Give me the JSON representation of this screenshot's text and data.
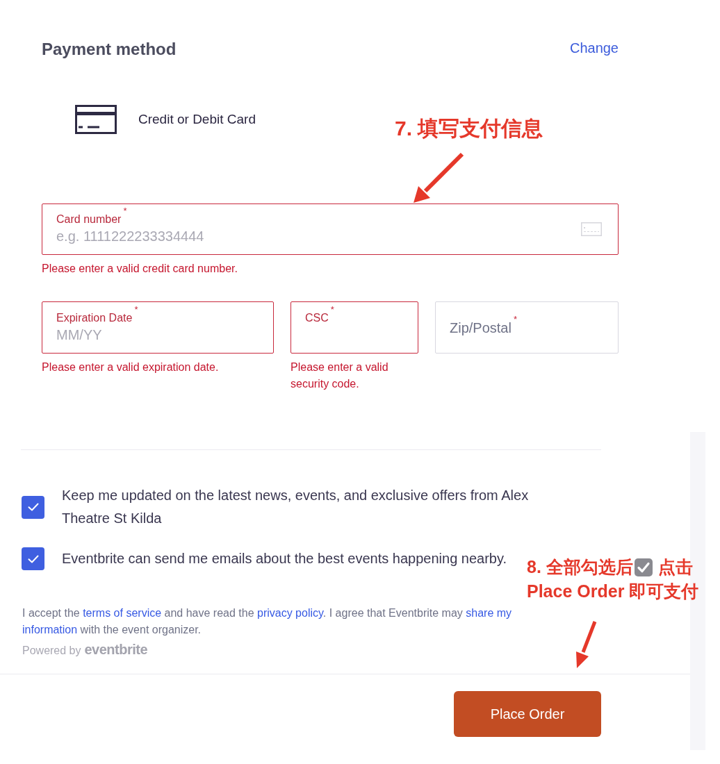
{
  "header": {
    "title": "Payment method",
    "change_link": "Change"
  },
  "payment_option": {
    "label": "Credit or Debit Card"
  },
  "field_rows": [
    {
      "fields": [
        {
          "kind": "card_number",
          "label": "Card number",
          "required_mark": "*",
          "placeholder": "e.g. 1111222233334444",
          "invalid": true,
          "label_floated": true,
          "error": "Please enter a valid credit card number."
        }
      ]
    },
    {
      "fields": [
        {
          "kind": "expiry",
          "label": "Expiration Date",
          "required_mark": "*",
          "placeholder": "MM/YY",
          "invalid": true,
          "label_floated": true,
          "error": "Please enter a valid expiration date."
        },
        {
          "kind": "csc",
          "label": "CSC",
          "required_mark": "*",
          "invalid": true,
          "label_floated": true,
          "error": "Please enter a valid security code."
        },
        {
          "kind": "postal",
          "label": "Zip/Postal",
          "required_mark": "*",
          "invalid": false,
          "label_floated": false
        }
      ]
    }
  ],
  "checkboxes": [
    {
      "label": "Keep me updated on the latest news, events, and exclusive offers from Alex Theatre St Kilda",
      "checked": true
    },
    {
      "label": "Eventbrite can send me emails about the best events happening nearby.",
      "checked": true
    }
  ],
  "legal_text": [
    {
      "kind": "text",
      "text": "I accept the "
    },
    {
      "kind": "link",
      "text": "terms of service"
    },
    {
      "kind": "text",
      "text": " and have read the "
    },
    {
      "kind": "link",
      "text": "privacy policy"
    },
    {
      "kind": "text",
      "text": ". I agree that Eventbrite may "
    },
    {
      "kind": "link",
      "text": "share my"
    },
    {
      "kind": "link",
      "text": "information"
    },
    {
      "kind": "text",
      "text": " with the event organizer."
    }
  ],
  "powered_by": {
    "label": "Powered by",
    "logo_text": "eventbrite"
  },
  "place_order_button": "Place Order",
  "annotations": [
    {
      "kind": "single_line",
      "text": "7. 填写支付信息"
    },
    {
      "kind": "with_icon",
      "text_before_icon": "8. 全部勾选后",
      "text_after_icon": "点击",
      "second_line": "Place Order 即可支付"
    }
  ]
}
